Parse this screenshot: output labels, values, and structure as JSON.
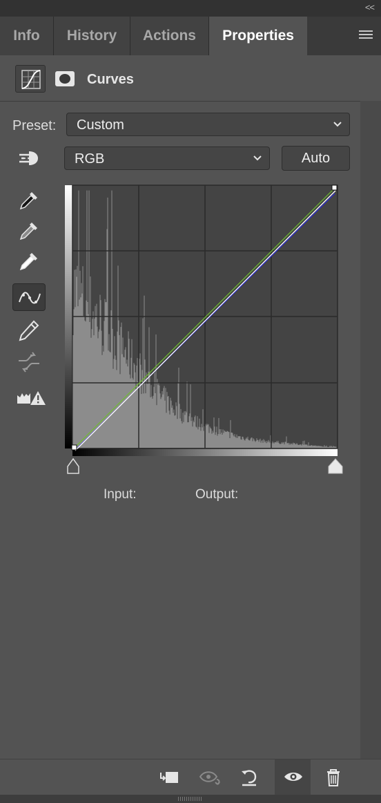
{
  "tabs": [
    {
      "label": "Info",
      "active": false
    },
    {
      "label": "History",
      "active": false
    },
    {
      "label": "Actions",
      "active": false
    },
    {
      "label": "Properties",
      "active": true
    }
  ],
  "collapse_glyph": "<<",
  "header": {
    "title": "Curves",
    "icons": [
      "curves-adjustment-icon",
      "layer-mask-icon"
    ]
  },
  "preset": {
    "label": "Preset:",
    "value": "Custom"
  },
  "channel": {
    "value": "RGB"
  },
  "auto_label": "Auto",
  "tools": [
    "on-image-adjust-icon",
    "black-point-eyedropper-icon",
    "gray-point-eyedropper-icon",
    "white-point-eyedropper-icon",
    "edit-points-curve-icon",
    "draw-pencil-icon",
    "smooth-curve-icon",
    "clipping-warning-icon"
  ],
  "readout": {
    "input_label": "Input:",
    "output_label": "Output:"
  },
  "curves": {
    "channels": [
      {
        "name": "RGB",
        "color": "#ffffff"
      },
      {
        "name": "Green",
        "color": "#6fbf2f"
      },
      {
        "name": "Blue",
        "color": "#2b2bd6"
      }
    ],
    "grid": "4x4",
    "colors": {
      "background": "#444444",
      "histogram": "#8c8c8c",
      "grid": "#2a2a2a"
    }
  },
  "footer_icons": [
    "clip-to-layer-icon",
    "view-previous-state-icon",
    "reset-icon",
    "visibility-eye-icon",
    "trash-icon"
  ]
}
